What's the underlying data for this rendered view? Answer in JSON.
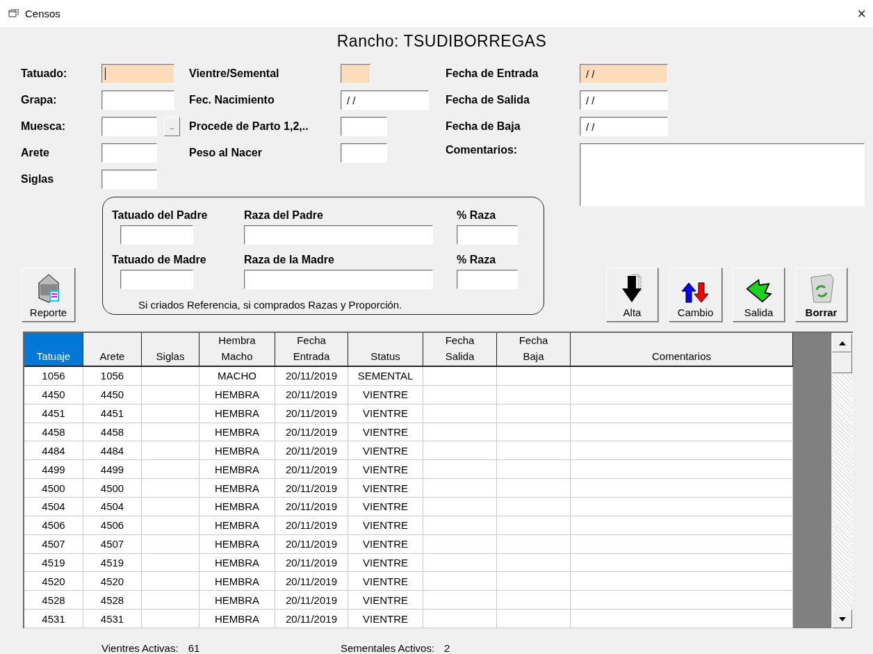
{
  "window": {
    "title": "Censos",
    "close": "×"
  },
  "heading": "Rancho: TSUDIBORREGAS",
  "fields_left": [
    {
      "label": "Tatuado:",
      "highlighted": true,
      "focused": true
    },
    {
      "label": "Grapa:",
      "highlighted": false,
      "focused": false
    },
    {
      "label": "Muesca:",
      "highlighted": false,
      "focused": false,
      "button": ".."
    },
    {
      "label": "Arete",
      "highlighted": false,
      "focused": false
    },
    {
      "label": "Siglas",
      "highlighted": false,
      "focused": false
    }
  ],
  "fields_middle": [
    {
      "label": "Vientre/Semental",
      "highlighted": true,
      "focused": false
    },
    {
      "label": "Fec. Nacimiento",
      "value": "/ /",
      "highlighted": false,
      "focused": false
    },
    {
      "label": "Procede de Parto 1,2,..",
      "highlighted": false,
      "focused": false
    },
    {
      "label": "Peso al Nacer",
      "highlighted": false,
      "focused": false
    }
  ],
  "fields_right": [
    {
      "label": "Fecha de Entrada",
      "value": "/ /",
      "highlighted": true,
      "focused": false,
      "kind": "line"
    },
    {
      "label": "Fecha de Salida",
      "value": "/ /",
      "highlighted": false,
      "focused": false,
      "kind": "line"
    },
    {
      "label": "Fecha de Baja",
      "value": "/ /",
      "highlighted": false,
      "focused": false,
      "kind": "line"
    },
    {
      "label": "Comentarios:",
      "highlighted": false,
      "focused": false,
      "kind": "textarea"
    }
  ],
  "parents": {
    "rows": [
      {
        "tatuado_label": "Tatuado del Padre",
        "raza_label": "Raza del Padre",
        "percent_label": "% Raza"
      },
      {
        "tatuado_label": "Tatuado de Madre",
        "raza_label": "Raza de la Madre",
        "percent_label": "% Raza"
      }
    ],
    "note": "Si criados Referencia, si comprados Razas y Proporción."
  },
  "report_button": {
    "label": "Reporte"
  },
  "actions": [
    {
      "label": "Alta",
      "kind": "add",
      "emphasized": false
    },
    {
      "label": "Cambio",
      "kind": "swap",
      "emphasized": false
    },
    {
      "label": "Salida",
      "kind": "exit",
      "emphasized": false
    },
    {
      "label": "Borrar",
      "kind": "trash",
      "emphasized": true
    }
  ],
  "table": {
    "columns": [
      {
        "lines": [
          "Tatuaje"
        ],
        "selected": true
      },
      {
        "lines": [
          "Arete"
        ],
        "selected": false
      },
      {
        "lines": [
          "Siglas"
        ],
        "selected": false
      },
      {
        "lines": [
          "Hembra",
          "Macho"
        ],
        "selected": false
      },
      {
        "lines": [
          "Fecha",
          "Entrada"
        ],
        "selected": false
      },
      {
        "lines": [
          "Status"
        ],
        "selected": false
      },
      {
        "lines": [
          "Fecha",
          "Salida"
        ],
        "selected": false
      },
      {
        "lines": [
          "Fecha",
          "Baja"
        ],
        "selected": false
      },
      {
        "lines": [
          "Comentarios"
        ],
        "selected": false
      }
    ],
    "rows": [
      {
        "tatuaje": "1056",
        "arete": "1056",
        "sexo": "MACHO",
        "fecha_entrada": "20/11/2019",
        "status": "SEMENTAL"
      },
      {
        "tatuaje": "4450",
        "arete": "4450",
        "sexo": "HEMBRA",
        "fecha_entrada": "20/11/2019",
        "status": "VIENTRE"
      },
      {
        "tatuaje": "4451",
        "arete": "4451",
        "sexo": "HEMBRA",
        "fecha_entrada": "20/11/2019",
        "status": "VIENTRE"
      },
      {
        "tatuaje": "4458",
        "arete": "4458",
        "sexo": "HEMBRA",
        "fecha_entrada": "20/11/2019",
        "status": "VIENTRE"
      },
      {
        "tatuaje": "4484",
        "arete": "4484",
        "sexo": "HEMBRA",
        "fecha_entrada": "20/11/2019",
        "status": "VIENTRE"
      },
      {
        "tatuaje": "4499",
        "arete": "4499",
        "sexo": "HEMBRA",
        "fecha_entrada": "20/11/2019",
        "status": "VIENTRE"
      },
      {
        "tatuaje": "4500",
        "arete": "4500",
        "sexo": "HEMBRA",
        "fecha_entrada": "20/11/2019",
        "status": "VIENTRE"
      },
      {
        "tatuaje": "4504",
        "arete": "4504",
        "sexo": "HEMBRA",
        "fecha_entrada": "20/11/2019",
        "status": "VIENTRE"
      },
      {
        "tatuaje": "4506",
        "arete": "4506",
        "sexo": "HEMBRA",
        "fecha_entrada": "20/11/2019",
        "status": "VIENTRE"
      },
      {
        "tatuaje": "4507",
        "arete": "4507",
        "sexo": "HEMBRA",
        "fecha_entrada": "20/11/2019",
        "status": "VIENTRE"
      },
      {
        "tatuaje": "4519",
        "arete": "4519",
        "sexo": "HEMBRA",
        "fecha_entrada": "20/11/2019",
        "status": "VIENTRE"
      },
      {
        "tatuaje": "4520",
        "arete": "4520",
        "sexo": "HEMBRA",
        "fecha_entrada": "20/11/2019",
        "status": "VIENTRE"
      },
      {
        "tatuaje": "4528",
        "arete": "4528",
        "sexo": "HEMBRA",
        "fecha_entrada": "20/11/2019",
        "status": "VIENTRE"
      },
      {
        "tatuaje": "4531",
        "arete": "4531",
        "sexo": "HEMBRA",
        "fecha_entrada": "20/11/2019",
        "status": "VIENTRE"
      }
    ]
  },
  "footer": [
    {
      "label": "Vientres Activas:",
      "value": "61"
    },
    {
      "label": "Sementales Activos:",
      "value": "2"
    }
  ]
}
